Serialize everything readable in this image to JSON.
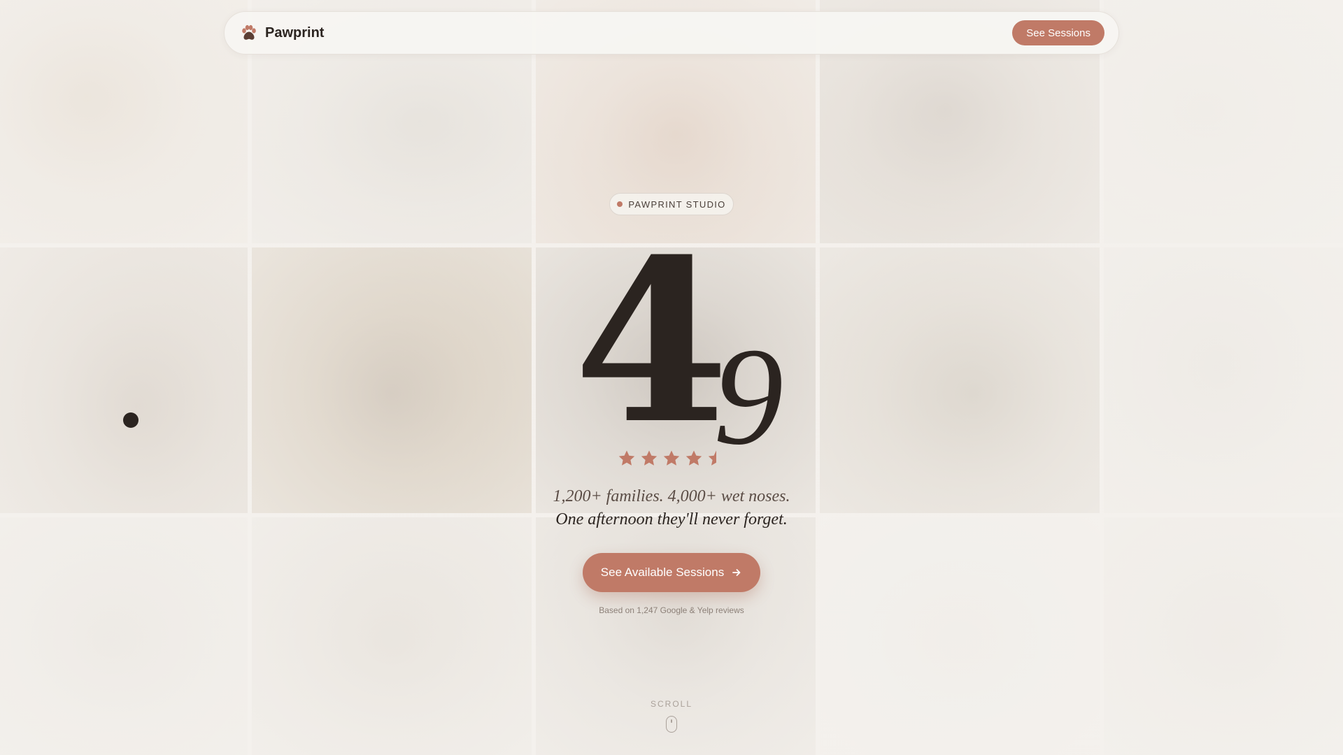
{
  "colors": {
    "accent": "#c07a67",
    "text_dark": "#2b2420",
    "page_bg": "#efebe6"
  },
  "nav": {
    "brand": "Pawprint",
    "brand_icon": "paw-icon",
    "cta_label": "See Sessions"
  },
  "hero": {
    "badge": "PAWPRINT STUDIO",
    "rating_integer": "4",
    "rating_decimal": "9",
    "rating_value": 4.5,
    "rating_max": 5,
    "tagline_line1": "1,200+ families. 4,000+ wet noses.",
    "tagline_line2": "One afternoon they'll never forget.",
    "cta_label": "See Available Sessions",
    "cta_icon": "arrow-right-icon",
    "reviews_note": "Based on 1,247 Google & Yelp reviews"
  },
  "scroll": {
    "label": "SCROLL",
    "icon": "mouse-icon"
  },
  "background": {
    "tile_count": 15
  }
}
